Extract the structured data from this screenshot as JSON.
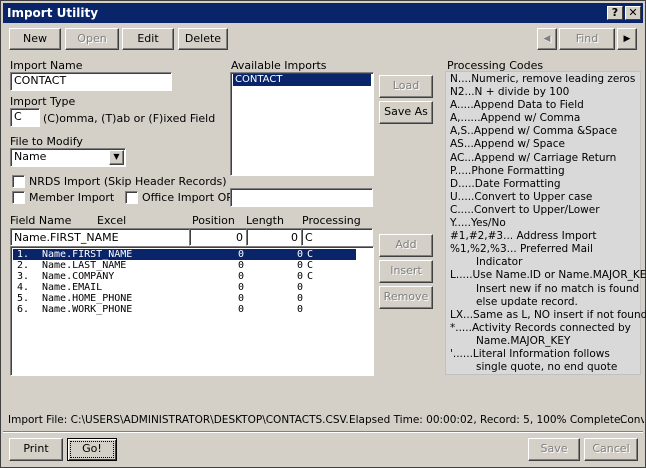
{
  "window": {
    "title": "Import Utility",
    "help_glyph": "?",
    "close_glyph": "✕"
  },
  "toolbar": {
    "new": "New",
    "open": "Open",
    "edit": "Edit",
    "delete": "Delete",
    "prev_glyph": "◀",
    "find": "Find",
    "next_glyph": "▶"
  },
  "form": {
    "import_name_label": "Import Name",
    "import_name_value": "CONTACT",
    "import_type_label": "Import Type",
    "import_type_value": "C",
    "import_type_hint": "(C)omma, (T)ab or (F)ixed Field",
    "file_to_modify_label": "File to Modify",
    "file_to_modify_value": "Name",
    "nrds_label": "NRDS Import (Skip Header Records)",
    "member_import_label": "Member Import",
    "office_import_label": "Office Import OR:",
    "office_import_value": ""
  },
  "available_imports": {
    "label": "Available Imports",
    "items": [
      "CONTACT"
    ],
    "load": "Load",
    "save_as": "Save As"
  },
  "fields": {
    "headers": {
      "field_name": "Field Name",
      "excel": "Excel",
      "position": "Position",
      "length": "Length",
      "processing": "Processing"
    },
    "edit_row": {
      "field_name": "Name.FIRST_NAME",
      "position": "0",
      "length": "0",
      "processing": "C"
    },
    "rows": [
      {
        "num": "1.",
        "field": "Name.FIRST_NAME",
        "position": "0",
        "length": "0",
        "processing": "C"
      },
      {
        "num": "2.",
        "field": "Name.LAST_NAME",
        "position": "0",
        "length": "0",
        "processing": "C"
      },
      {
        "num": "3.",
        "field": "Name.COMPANY",
        "position": "0",
        "length": "0",
        "processing": "C"
      },
      {
        "num": "4.",
        "field": "Name.EMAIL",
        "position": "0",
        "length": "0",
        "processing": ""
      },
      {
        "num": "5.",
        "field": "Name.HOME_PHONE",
        "position": "0",
        "length": "0",
        "processing": ""
      },
      {
        "num": "6.",
        "field": "Name.WORK_PHONE",
        "position": "0",
        "length": "0",
        "processing": ""
      }
    ],
    "add": "Add",
    "insert": "Insert",
    "remove": "Remove"
  },
  "processing_codes": {
    "label": "Processing Codes",
    "lines": [
      "N....Numeric, remove leading zeros",
      "N2...N + divide by 100",
      "A.....Append Data to Field",
      "A,......Append w/ Comma",
      "A,S..Append w/ Comma &Space",
      "AS...Append w/ Space",
      "AC...Append w/ Carriage Return",
      "P.....Phone Formatting",
      "D.....Date Formatting",
      "U.....Convert to Upper case",
      "C.....Convert to Upper/Lower",
      "Y.....Yes/No",
      "#1,#2,#3... Address Import",
      "%1,%2,%3... Preferred Mail",
      "          Indicator",
      "L.....Use Name.ID or Name.MAJOR_KEY",
      "          Insert new if no match is found",
      "          else update record.",
      "LX...Same as L, NO insert if not found",
      "*.....Activity Records connected by",
      "          Name.MAJOR_KEY",
      "'......Literal Information follows",
      "          single quote, no end quote"
    ]
  },
  "status": {
    "import_file": "Import File: C:\\USERS\\ADMINISTRATOR\\DESKTOP\\CONTACTS.CSV.",
    "elapsed": "Elapsed Time: 00:00:02, Record: 5, 100% Complete.",
    "trailing": "Conv"
  },
  "footer": {
    "print": "Print",
    "go": "Go!",
    "save": "Save",
    "cancel": "Cancel"
  }
}
